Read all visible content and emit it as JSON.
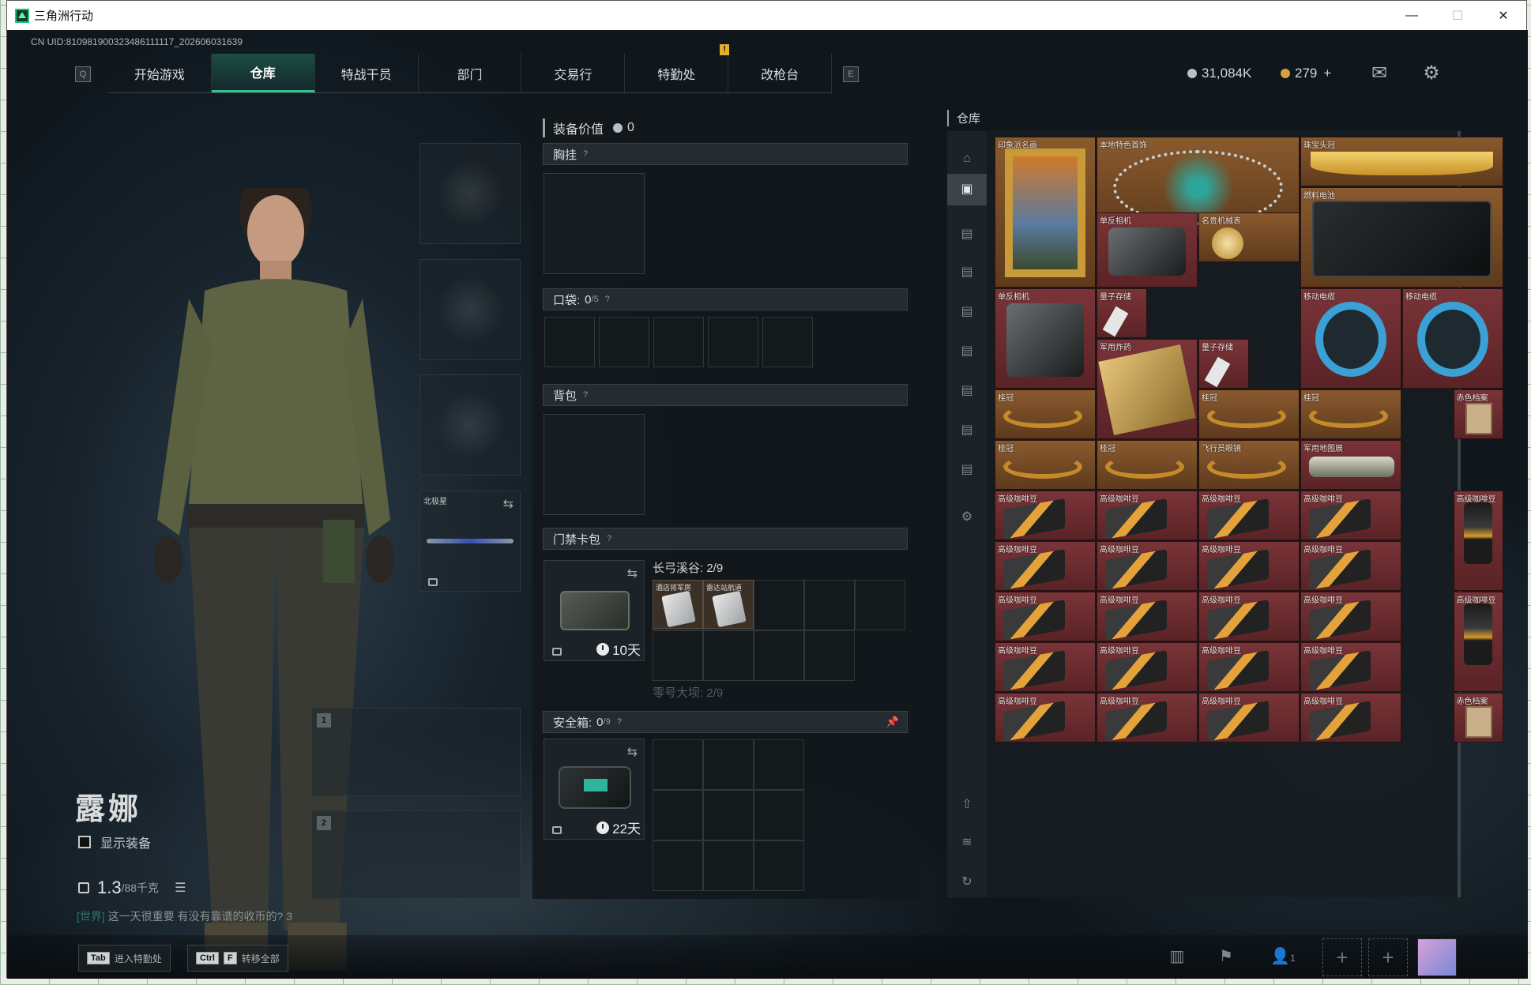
{
  "window": {
    "title": "三角洲行动",
    "controls": [
      "—",
      "☐",
      "✕"
    ]
  },
  "uid": "CN UID:810981900323486111117_202606031639",
  "nav": {
    "key_left": "Q",
    "key_right": "E",
    "tabs": [
      "开始游戏",
      "仓库",
      "特战干员",
      "部门",
      "交易行",
      "特勤处",
      "改枪台"
    ],
    "active": "仓库"
  },
  "currency": {
    "silver": "31,084K",
    "gold": "279",
    "gold_plus": "+"
  },
  "character": {
    "name": "露娜",
    "show_equip": "显示装备",
    "weight": "1.3",
    "weight_max": "/88千克"
  },
  "chat": {
    "channel": "[世界]",
    "text": "这一天很重要 有没有靠谱的收币的? 3"
  },
  "hints": [
    {
      "keys": [
        "Tab"
      ],
      "label": "进入特勤处"
    },
    {
      "keys": [
        "Ctrl",
        "F"
      ],
      "label": "转移全部"
    }
  ],
  "equip": {
    "value_label": "装备价值",
    "value": "0",
    "chest": "胸挂",
    "pocket": "口袋:",
    "pocket_count": "0",
    "pocket_max": "/5",
    "backpack": "背包",
    "keycard_bag": "门禁卡包",
    "keycard_days": "10天",
    "map1": "长弓溪谷: 2/9",
    "map2": "零号大坝: 2/9",
    "keycards": [
      "酒店将军房",
      "雷达站航道"
    ],
    "secure": "安全箱:",
    "secure_count": "0",
    "secure_max": "/9",
    "secure_days": "22天",
    "weapon_label": "北极星",
    "slot1": "1",
    "slot2": "2"
  },
  "storage": {
    "title": "仓库",
    "items": [
      {
        "name": "印象派名画",
        "c": 0,
        "r": 0,
        "w": 1,
        "h": 3,
        "art": "painting"
      },
      {
        "name": "本地特色首饰",
        "c": 1,
        "r": 0,
        "w": 2,
        "h": 2,
        "art": "jewel"
      },
      {
        "name": "珠宝头冠",
        "c": 3,
        "r": 0,
        "w": 2,
        "h": 1,
        "art": "crown"
      },
      {
        "name": "燃料电池",
        "c": 3,
        "r": 1,
        "w": 2,
        "h": 2,
        "art": "battery"
      },
      {
        "name": "单反相机",
        "c": 1,
        "r": 1.5,
        "w": 1,
        "h": 1.5,
        "art": "camera"
      },
      {
        "name": "名贵机械表",
        "c": 2,
        "r": 1.5,
        "w": 1,
        "h": 1,
        "art": "watch"
      },
      {
        "name": "单反相机",
        "c": 0,
        "r": 3,
        "w": 1,
        "h": 2,
        "art": "camera"
      },
      {
        "name": "量子存储",
        "c": 1,
        "r": 3,
        "w": 0.5,
        "h": 1,
        "art": "usb"
      },
      {
        "name": "移动电缆",
        "c": 3,
        "r": 3,
        "w": 1,
        "h": 2,
        "art": "reel"
      },
      {
        "name": "移动电缆",
        "c": 4,
        "r": 3,
        "w": 1,
        "h": 2,
        "art": "reel"
      },
      {
        "name": "军用炸药",
        "c": 1,
        "r": 4,
        "w": 1,
        "h": 2,
        "art": "crate"
      },
      {
        "name": "量子存储",
        "c": 2,
        "r": 4,
        "w": 0.5,
        "h": 1,
        "art": "usb"
      }
    ],
    "grid_items": [
      [
        "桂冠",
        "",
        "桂冠",
        "桂冠",
        "赤色档案"
      ],
      [
        "桂冠",
        "桂冠",
        "飞行员眼镜",
        "军用地图展",
        ""
      ],
      [
        "高级咖啡豆",
        "高级咖啡豆",
        "高级咖啡豆",
        "高级咖啡豆",
        "高级咖啡豆"
      ],
      [
        "高级咖啡豆",
        "高级咖啡豆",
        "高级咖啡豆",
        "高级咖啡豆",
        ""
      ],
      [
        "高级咖啡豆",
        "高级咖啡豆",
        "高级咖啡豆",
        "高级咖啡豆",
        "高级咖啡豆"
      ],
      [
        "高级咖啡豆",
        "高级咖啡豆",
        "高级咖啡豆",
        "高级咖啡豆",
        ""
      ],
      [
        "高级咖啡豆",
        "高级咖啡豆",
        "高级咖啡豆",
        "高级咖啡豆",
        "赤色档案"
      ]
    ]
  },
  "social": {
    "friends": "1"
  }
}
